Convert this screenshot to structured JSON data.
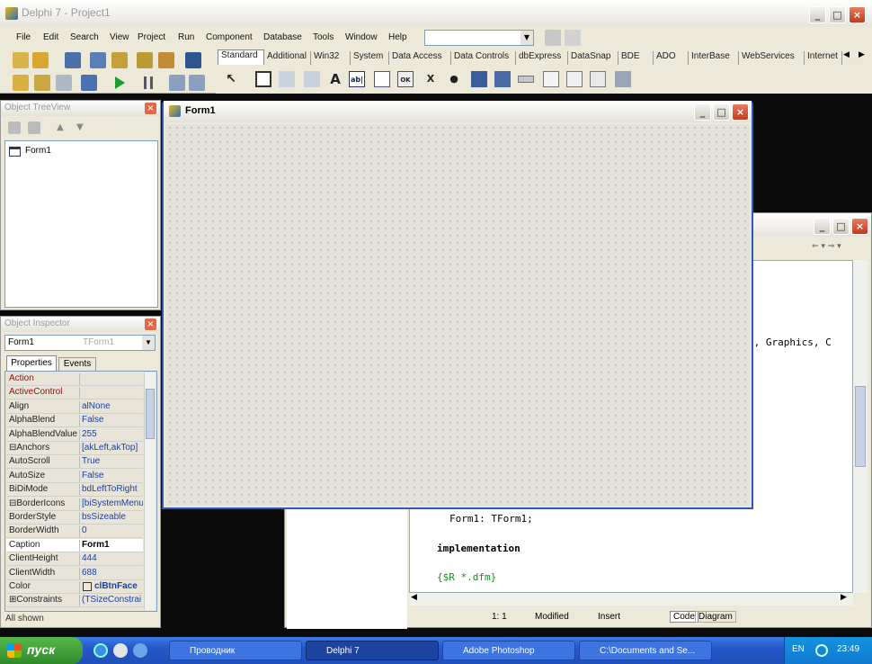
{
  "ide": {
    "title": "Delphi 7 - Project1",
    "menus": [
      "File",
      "Edit",
      "Search",
      "View",
      "Project",
      "Run",
      "Component",
      "Database",
      "Tools",
      "Window",
      "Help"
    ],
    "palette_tabs": [
      "Standard",
      "Additional",
      "Win32",
      "System",
      "Data Access",
      "Data Controls",
      "dbExpress",
      "DataSnap",
      "BDE",
      "ADO",
      "InterBase",
      "WebServices",
      "Internet"
    ],
    "active_tab": "Standard",
    "palette_glyphs": {
      "label": "A",
      "edit": "ab|",
      "memo": "OK",
      "checkbox": "X",
      "radio": "●"
    }
  },
  "tree_view": {
    "title": "Object TreeView",
    "items": [
      "Form1"
    ]
  },
  "inspector": {
    "title": "Object Inspector",
    "object_name": "Form1",
    "object_type": "TForm1",
    "tabs": [
      "Properties",
      "Events"
    ],
    "properties": [
      {
        "name": "Action",
        "value": "",
        "color": "#8a1010"
      },
      {
        "name": "ActiveControl",
        "value": "",
        "color": "#8a1010"
      },
      {
        "name": "Align",
        "value": "alNone",
        "color": "#222"
      },
      {
        "name": "AlphaBlend",
        "value": "False",
        "color": "#222"
      },
      {
        "name": "AlphaBlendValue",
        "value": "255",
        "color": "#222"
      },
      {
        "name": "⊟Anchors",
        "value": "[akLeft,akTop]",
        "color": "#222"
      },
      {
        "name": "AutoScroll",
        "value": "True",
        "color": "#222"
      },
      {
        "name": "AutoSize",
        "value": "False",
        "color": "#222"
      },
      {
        "name": "BiDiMode",
        "value": "bdLeftToRight",
        "color": "#222"
      },
      {
        "name": "⊟BorderIcons",
        "value": "[biSystemMenu",
        "color": "#222"
      },
      {
        "name": "BorderStyle",
        "value": "bsSizeable",
        "color": "#222"
      },
      {
        "name": "BorderWidth",
        "value": "0",
        "color": "#222"
      },
      {
        "name": "Caption",
        "value": "Form1",
        "color": "#222"
      },
      {
        "name": "ClientHeight",
        "value": "444",
        "color": "#222"
      },
      {
        "name": "ClientWidth",
        "value": "688",
        "color": "#222"
      },
      {
        "name": "Color",
        "value": "clBtnFace",
        "color": "#222"
      },
      {
        "name": "⊞Constraints",
        "value": "(TSizeConstrai",
        "color": "#222"
      }
    ],
    "selected_index": 12,
    "status": "All shown"
  },
  "form": {
    "title": "Form1"
  },
  "code_editor": {
    "line1": "s, Graphics, C",
    "line2": "Form1: TForm1;",
    "line3": "implementation",
    "line4": "{$R *.dfm}",
    "position": "1: 1",
    "modified": "Modified",
    "insert": "Insert",
    "tabs": [
      "Code",
      "Diagram"
    ]
  },
  "taskbar": {
    "start": "пуск",
    "buttons": [
      "Проводник",
      "Delphi 7",
      "Adobe Photoshop",
      "C:\\Documents and Se..."
    ],
    "lang": "EN",
    "clock": "23:49"
  }
}
